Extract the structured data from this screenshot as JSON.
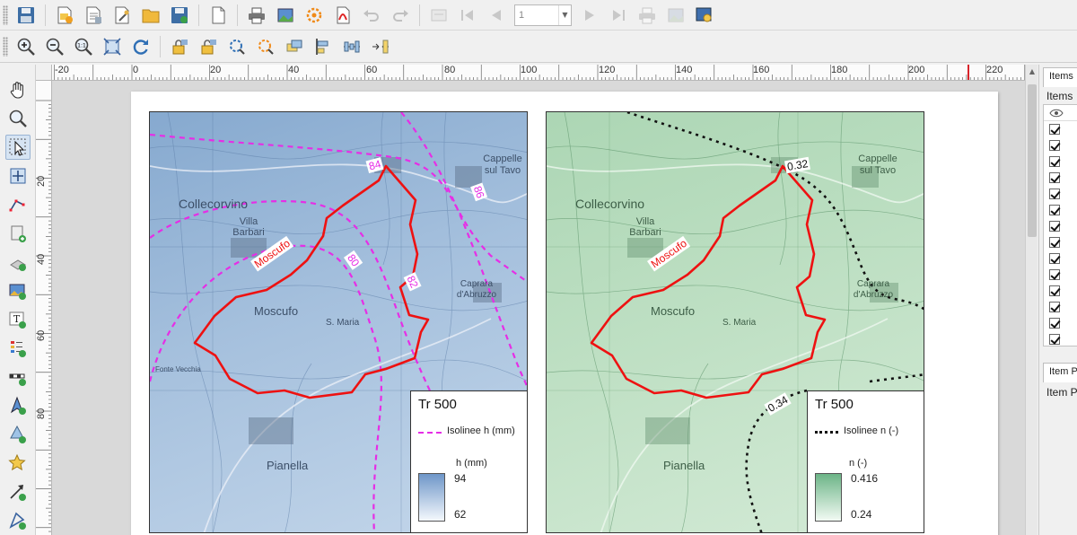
{
  "toolbar_top": {
    "buttons": [
      {
        "name": "save-project-button",
        "icon": "floppy-icon"
      },
      {
        "name": "new-composer-button",
        "icon": "new-composer-icon"
      },
      {
        "name": "duplicate-composer-button",
        "icon": "duplicate-composer-icon"
      },
      {
        "name": "composer-manager-button",
        "icon": "composer-manager-icon"
      },
      {
        "name": "load-template-button",
        "icon": "folder-icon"
      },
      {
        "name": "save-template-button",
        "icon": "save-template-icon"
      },
      {
        "name": "new-report-button",
        "icon": "page-icon"
      },
      {
        "name": "print-button",
        "icon": "printer-icon"
      },
      {
        "name": "export-image-button",
        "icon": "export-image-icon"
      },
      {
        "name": "export-svg-button",
        "icon": "export-svg-icon"
      },
      {
        "name": "export-pdf-button",
        "icon": "pdf-icon"
      },
      {
        "name": "undo-button",
        "icon": "undo-icon"
      },
      {
        "name": "redo-button",
        "icon": "redo-icon"
      }
    ],
    "atlas_page_value": "1"
  },
  "hruler": {
    "labels": [
      "-20",
      "0",
      "20",
      "40",
      "60",
      "80",
      "100",
      "120",
      "140",
      "160",
      "180",
      "200",
      "220"
    ]
  },
  "vruler": {
    "labels": [
      "20",
      "40",
      "60",
      "80"
    ]
  },
  "layout": {
    "map_left": {
      "place_labels": [
        "Collecorvino",
        "Villa Barbari",
        "Moscufo",
        "S. Maria",
        "Pianella",
        "Cappelle sul Tavo",
        "Caprara d'Abruzzo",
        "Fonte Vecchia"
      ],
      "watershed_label": "Moscufo",
      "isoline_labels": [
        "84",
        "86",
        "80",
        "82"
      ],
      "legend": {
        "title": "Tr 500",
        "line_label": "Isolinee h (mm)",
        "line_color": "#e62ee6",
        "ramp_title": "h (mm)",
        "ramp_max": "94",
        "ramp_min": "62",
        "ramp_color_high": "#6e96c8",
        "ramp_color_low": "#f4f8fc"
      }
    },
    "map_right": {
      "place_labels": [
        "Collecorvino",
        "Villa Barbari",
        "Moscufo",
        "S. Maria",
        "Pianella",
        "Cappelle sul Tavo",
        "Caprara d'Abruzzo"
      ],
      "watershed_label": "Moscufo",
      "isoline_labels": [
        "0.32",
        "0.34"
      ],
      "legend": {
        "title": "Tr 500",
        "line_label": "Isolinee n (-)",
        "line_color": "#111111",
        "ramp_title": "n (-)",
        "ramp_max": "0.416",
        "ramp_min": "0.24",
        "ramp_color_high": "#6cb487",
        "ramp_color_low": "#f2faf3"
      }
    },
    "watershed_color": "#ee1111"
  },
  "dock": {
    "tab_items": "Items",
    "heading_items": "Items",
    "tab_item_properties": "Item P",
    "heading_item_properties": "Item P",
    "item_count": 14
  }
}
